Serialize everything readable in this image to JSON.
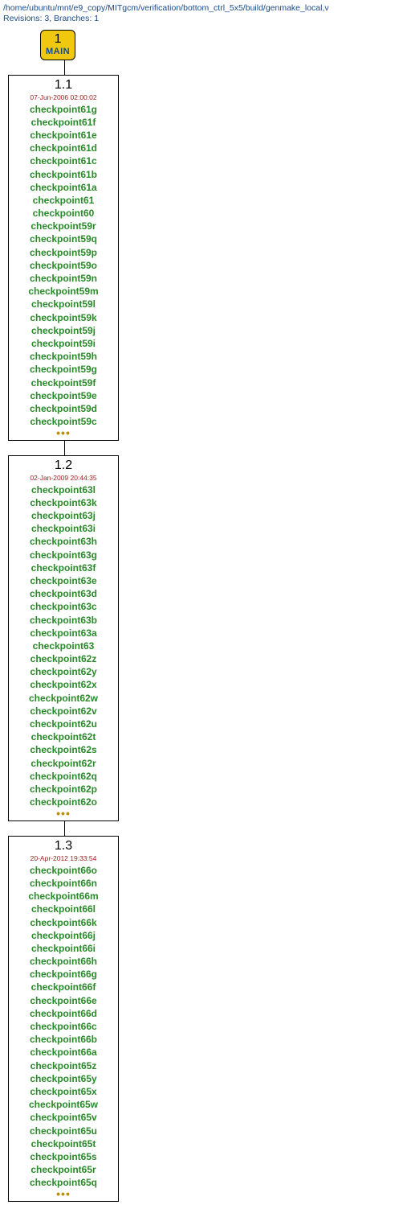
{
  "header": {
    "path": "/home/ubuntu/mnt/e9_copy/MITgcm/verification/bottom_ctrl_5x5/build/genmake_local,v",
    "meta": "Revisions: 3, Branches: 1"
  },
  "branch": {
    "number": "1",
    "name": "MAIN"
  },
  "revisions": [
    {
      "number": "1.1",
      "date": "07-Jun-2006 02:00:02",
      "tags": [
        "checkpoint61g",
        "checkpoint61f",
        "checkpoint61e",
        "checkpoint61d",
        "checkpoint61c",
        "checkpoint61b",
        "checkpoint61a",
        "checkpoint61",
        "checkpoint60",
        "checkpoint59r",
        "checkpoint59q",
        "checkpoint59p",
        "checkpoint59o",
        "checkpoint59n",
        "checkpoint59m",
        "checkpoint59l",
        "checkpoint59k",
        "checkpoint59j",
        "checkpoint59i",
        "checkpoint59h",
        "checkpoint59g",
        "checkpoint59f",
        "checkpoint59e",
        "checkpoint59d",
        "checkpoint59c"
      ],
      "ellipsis": "•••"
    },
    {
      "number": "1.2",
      "date": "02-Jan-2009 20:44:35",
      "tags": [
        "checkpoint63l",
        "checkpoint63k",
        "checkpoint63j",
        "checkpoint63i",
        "checkpoint63h",
        "checkpoint63g",
        "checkpoint63f",
        "checkpoint63e",
        "checkpoint63d",
        "checkpoint63c",
        "checkpoint63b",
        "checkpoint63a",
        "checkpoint63",
        "checkpoint62z",
        "checkpoint62y",
        "checkpoint62x",
        "checkpoint62w",
        "checkpoint62v",
        "checkpoint62u",
        "checkpoint62t",
        "checkpoint62s",
        "checkpoint62r",
        "checkpoint62q",
        "checkpoint62p",
        "checkpoint62o"
      ],
      "ellipsis": "•••"
    },
    {
      "number": "1.3",
      "date": "20-Apr-2012 19:33:54",
      "tags": [
        "checkpoint66o",
        "checkpoint66n",
        "checkpoint66m",
        "checkpoint66l",
        "checkpoint66k",
        "checkpoint66j",
        "checkpoint66i",
        "checkpoint66h",
        "checkpoint66g",
        "checkpoint66f",
        "checkpoint66e",
        "checkpoint66d",
        "checkpoint66c",
        "checkpoint66b",
        "checkpoint66a",
        "checkpoint65z",
        "checkpoint65y",
        "checkpoint65x",
        "checkpoint65w",
        "checkpoint65v",
        "checkpoint65u",
        "checkpoint65t",
        "checkpoint65s",
        "checkpoint65r",
        "checkpoint65q"
      ],
      "ellipsis": "•••"
    }
  ]
}
